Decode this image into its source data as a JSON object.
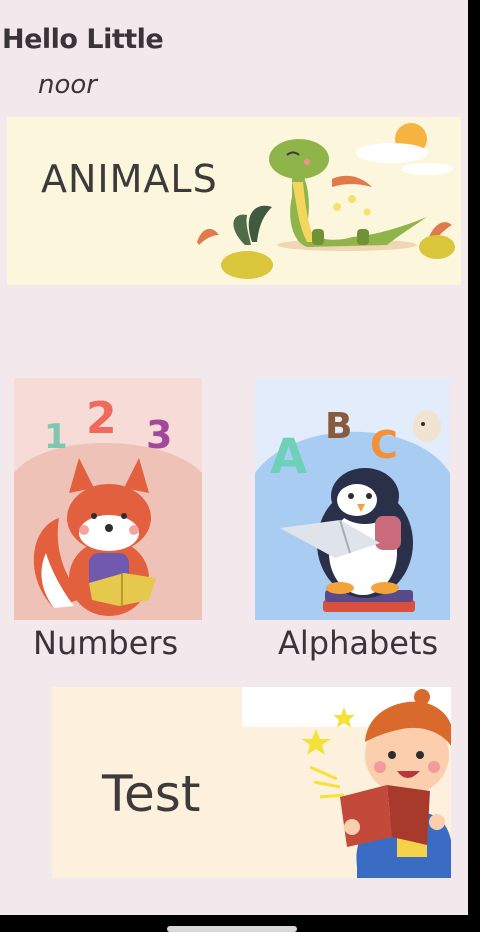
{
  "header": {
    "greeting": "Hello Little",
    "name": "noor"
  },
  "cards": {
    "animals": {
      "label": "ANIMALS"
    },
    "numbers": {
      "label": "Numbers",
      "digits": [
        "1",
        "2",
        "3"
      ]
    },
    "alphabets": {
      "label": "Alphabets",
      "letters": [
        "A",
        "B",
        "C"
      ]
    },
    "test": {
      "label": "Test"
    }
  },
  "icons": {
    "animals": "dinosaur-illustration",
    "numbers": "fox-reading-illustration",
    "alphabets": "penguin-reading-illustration",
    "test": "boy-reading-illustration"
  },
  "colors": {
    "background": "#f3e8ec",
    "text": "#3a3438"
  }
}
